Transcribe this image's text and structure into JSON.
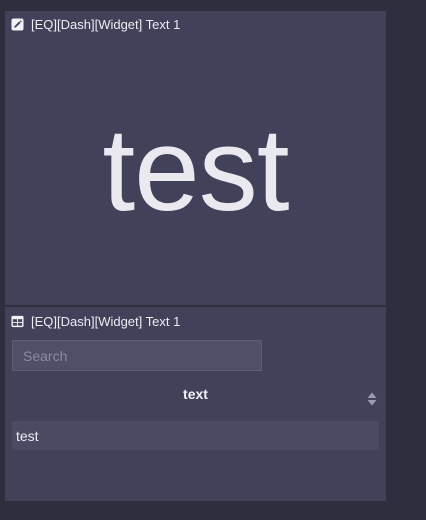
{
  "widgets": [
    {
      "title": "[EQ][Dash][Widget] Text 1",
      "icon": "edit-icon",
      "content": "test"
    },
    {
      "title": "[EQ][Dash][Widget] Text 1",
      "icon": "table-icon",
      "search": {
        "placeholder": "Search",
        "value": ""
      },
      "table": {
        "columns": [
          "text"
        ],
        "rows": [
          [
            "test"
          ]
        ]
      }
    }
  ],
  "colors": {
    "background": "#2e2e3f",
    "panel": "#41415a",
    "row": "#4a4a62",
    "input": "#4f4f67"
  }
}
